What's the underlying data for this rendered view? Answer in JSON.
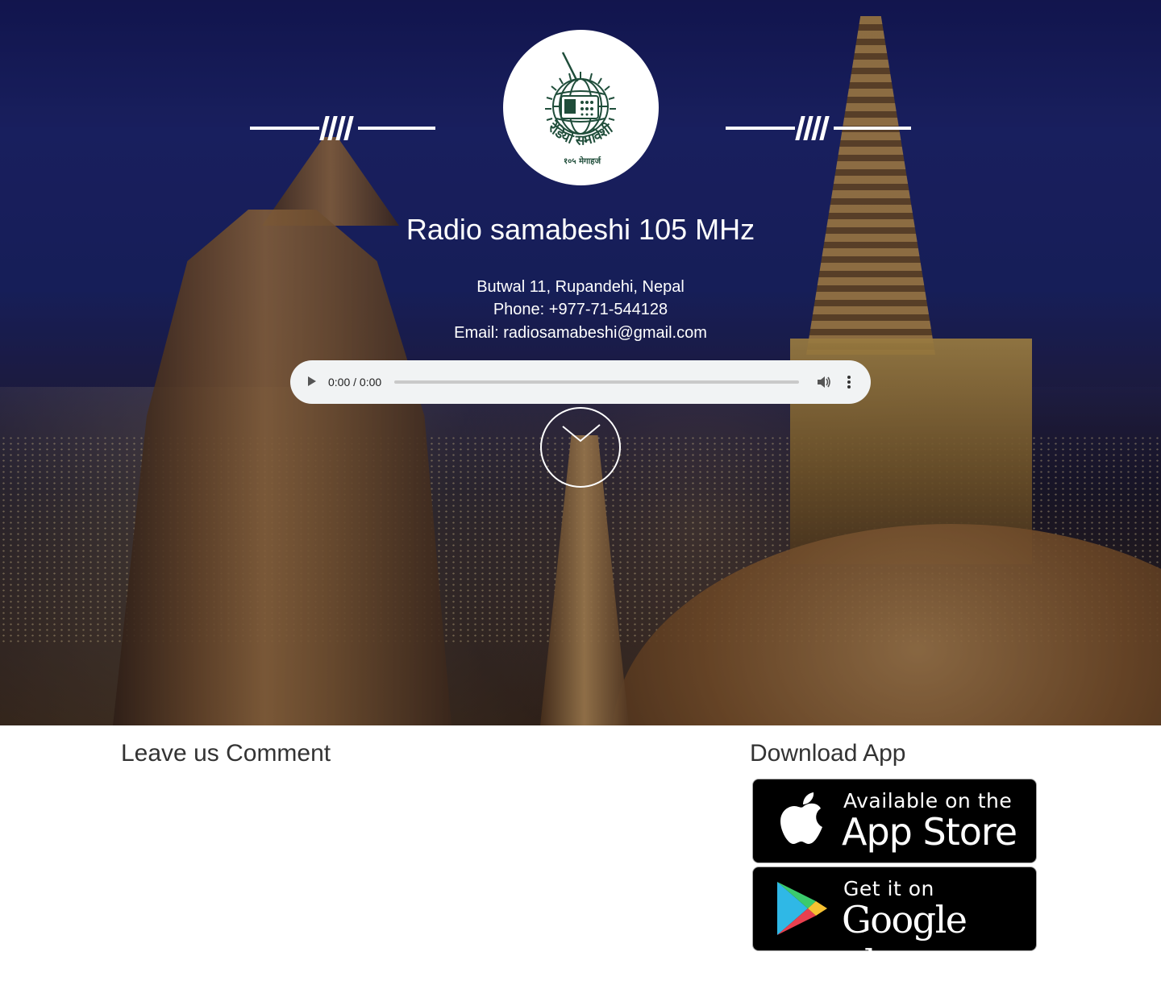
{
  "station": {
    "title": "Radio samabeshi 105 MHz",
    "address": "Butwal 11, Rupandehi, Nepal",
    "phone": "Phone: +977-71-544128",
    "email": "Email: radiosamabeshi@gmail.com",
    "logo_text": "रेडियो समावेशी",
    "logo_subtext": "१०५ मेगाहर्ज"
  },
  "player": {
    "time": "0:00 / 0:00",
    "progress": 0,
    "icons": [
      "play-icon",
      "volume-icon",
      "more-vertical-icon"
    ]
  },
  "scroll_icon": "chevron-down-icon",
  "comments": {
    "heading": "Leave us Comment"
  },
  "download": {
    "heading": "Download App",
    "app_store": {
      "small": "Available on the",
      "big": "App Store",
      "icon": "apple-icon"
    },
    "google_play": {
      "small": "Get it on",
      "big": "Google play",
      "icon": "google-play-icon"
    }
  },
  "colors": {
    "hero_sky": "#1a2468",
    "text_light": "#ffffff",
    "heading_dark": "#333333",
    "player_bg": "#f1f3f4",
    "logo_green": "#1f4d3a"
  }
}
